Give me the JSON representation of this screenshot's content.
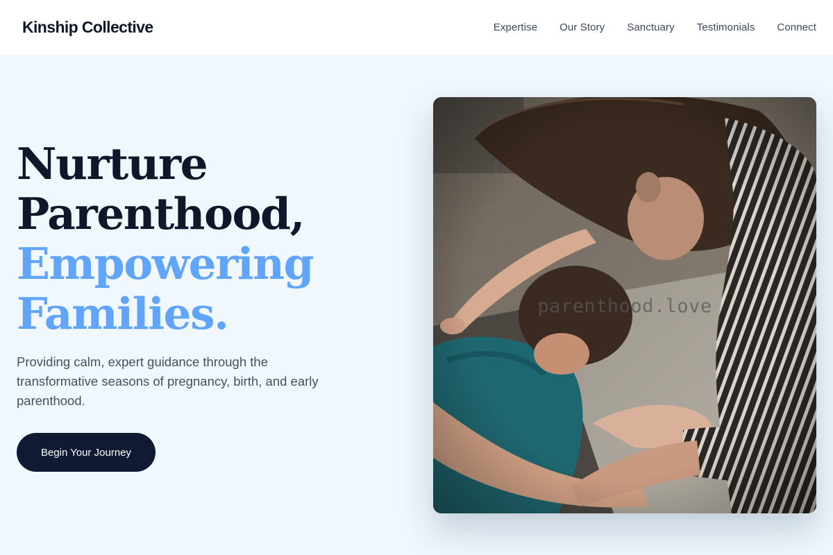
{
  "brand": {
    "name": "Kinship Collective"
  },
  "nav": {
    "items": [
      {
        "label": "Expertise"
      },
      {
        "label": "Our Story"
      },
      {
        "label": "Sanctuary"
      },
      {
        "label": "Testimonials"
      },
      {
        "label": "Connect"
      }
    ]
  },
  "hero": {
    "headline": {
      "line1": "Nurture",
      "line2": "Parenthood,",
      "line3": "Empowering",
      "line4": "Families."
    },
    "subtitle": "Providing calm, expert guidance through the transformative seasons of pregnancy, birth, and early parenthood.",
    "cta_label": "Begin Your Journey",
    "image": {
      "alt": "photo",
      "watermark": "parenthood.love"
    }
  },
  "colors": {
    "background": "#f0f7fd",
    "navy": "#111a33",
    "accent": "#60a5fa",
    "body_text": "#46505e"
  }
}
